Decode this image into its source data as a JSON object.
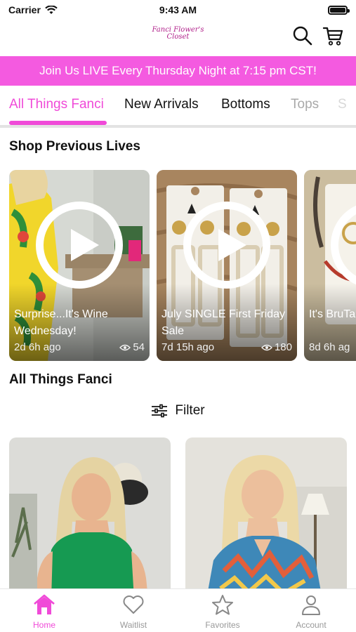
{
  "status_bar": {
    "carrier": "Carrier",
    "time": "9:43 AM"
  },
  "header": {
    "logo_line1": "Fanci Flower's",
    "logo_line2": "Closet"
  },
  "banner": {
    "text": "Join Us LIVE Every Thursday Night at 7:15 pm CST!"
  },
  "tabs": [
    {
      "label": "All Things Fanci"
    },
    {
      "label": "New Arrivals"
    },
    {
      "label": "Bottoms"
    },
    {
      "label": "Tops"
    },
    {
      "label": "S"
    }
  ],
  "lives_section": {
    "title": "Shop Previous Lives",
    "items": [
      {
        "title": "Surprise...It's Wine Wednesday!",
        "age": "2d 6h ago",
        "views": "54"
      },
      {
        "title": "July SINGLE First Friday Sale",
        "age": "7d 15h ago",
        "views": "180"
      },
      {
        "title": "It's BruTa Giveawa",
        "age": "8d 6h ag",
        "views": ""
      }
    ]
  },
  "products_section": {
    "title": "All Things Fanci",
    "filter_label": "Filter"
  },
  "tab_bar": [
    {
      "label": "Home"
    },
    {
      "label": "Waitlist"
    },
    {
      "label": "Favorites"
    },
    {
      "label": "Account"
    }
  ],
  "colors": {
    "brand_pink": "#f45ae0",
    "active_pink": "#f04ad8"
  },
  "icons": [
    "wifi-icon",
    "battery-icon",
    "search-icon",
    "cart-icon",
    "play-icon",
    "eye-icon",
    "filter-icon",
    "home-icon",
    "heart-icon",
    "star-icon",
    "person-icon"
  ]
}
